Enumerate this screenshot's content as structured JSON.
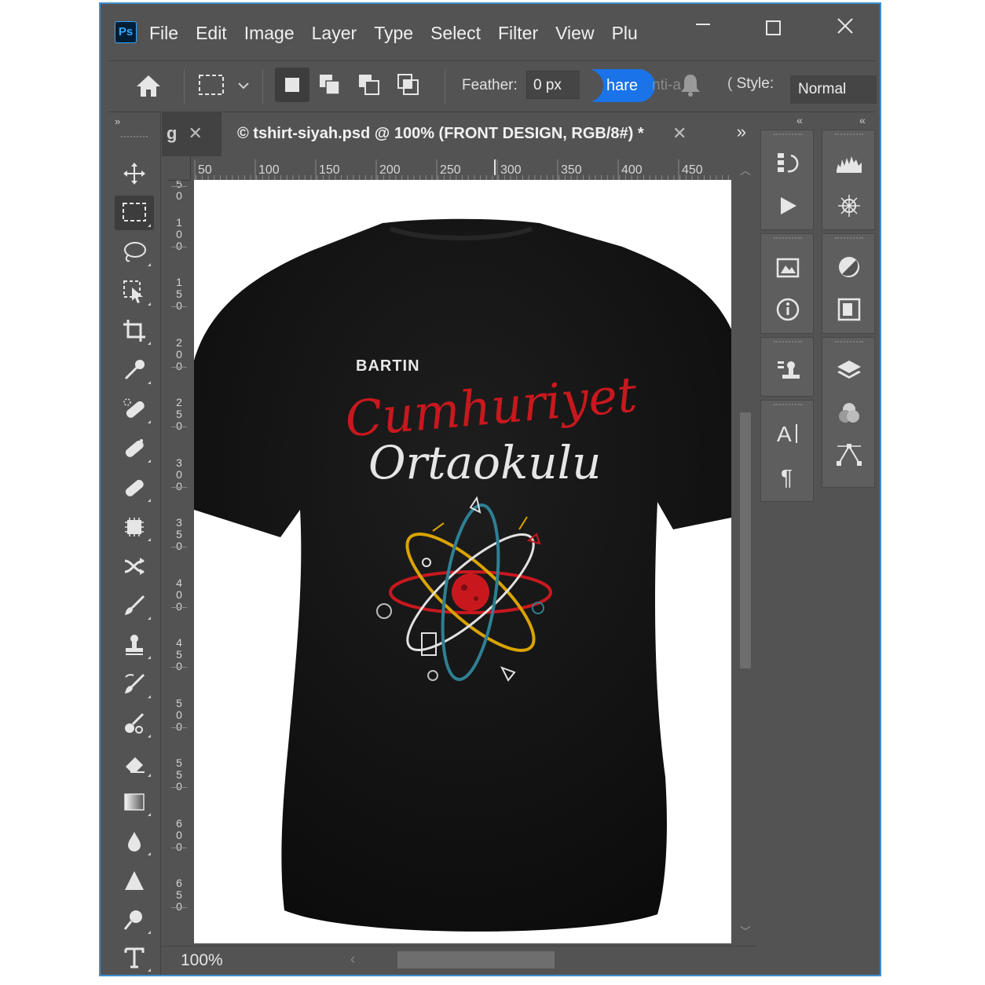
{
  "app": {
    "logo": "Ps"
  },
  "menu": [
    "File",
    "Edit",
    "Image",
    "Layer",
    "Type",
    "Select",
    "Filter",
    "View",
    "Plu"
  ],
  "options": {
    "feather_label": "Feather:",
    "feather_value": "0 px",
    "share_label": "hare",
    "anti_alias_fragment": "nti-a",
    "style_label": "Style:",
    "style_value": "Normal"
  },
  "doc": {
    "prev_tab": "g",
    "title": "© tshirt-siyah.psd @ 100% (FRONT DESIGN, RGB/8#) *",
    "zoom": "100%"
  },
  "ruler": {
    "h_ticks": [
      "50",
      "100",
      "150",
      "200",
      "250",
      "300",
      "350",
      "400",
      "450"
    ],
    "v_ticks": [
      "5\n0",
      "1\n0\n0",
      "1\n5\n0",
      "2\n0\n0",
      "2\n5\n0",
      "3\n0\n0",
      "3\n5\n0",
      "4\n0\n0",
      "4\n5\n0",
      "5\n0\n0",
      "5\n5\n0",
      "6\n0\n0",
      "6\n5\n0"
    ]
  },
  "design": {
    "line1": "BARTIN",
    "line2": "Cumhuriyet",
    "line3": "Ortaokulu"
  },
  "colors": {
    "accent": "#1a73e8",
    "shirt": "#161616",
    "design_red": "#c8181e"
  }
}
